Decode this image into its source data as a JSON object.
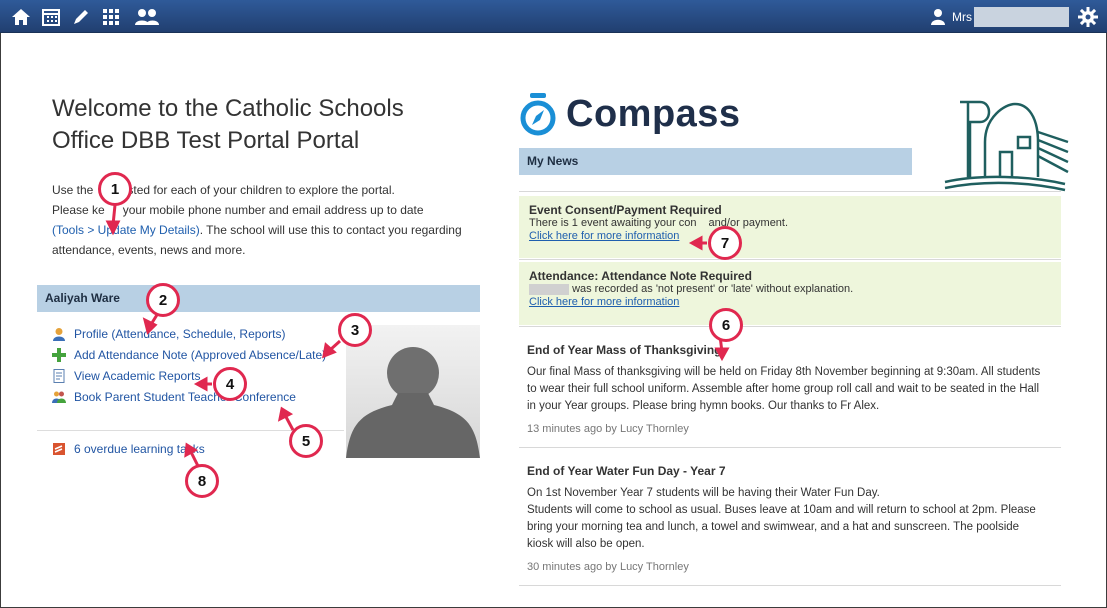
{
  "topbar": {
    "user_label": "Mrs",
    "nav_icons": [
      "home-icon",
      "calendar-icon",
      "pencil-icon",
      "grid-icon",
      "people-icon"
    ],
    "settings_icon": "gear-icon"
  },
  "welcome": {
    "title": "Welcome to the Catholic Schools Office DBB Test Portal Portal",
    "intro_before_link_1": "Use the",
    "intro_after_1": "sted for each of your children to explore the portal.",
    "intro_line_2_a": "Please ke",
    "intro_line_2_b": "your mobile phone number and email address up to date",
    "tools_link": "(Tools > Update My Details)",
    "intro_after_link": ". The school will use this to contact you regarding attendance, events, news and more."
  },
  "child": {
    "name": "Aaliyah Ware",
    "links": [
      {
        "label": "Profile (Attendance, Schedule, Reports)",
        "icon": "profile-icon"
      },
      {
        "label": "Add Attendance Note (Approved Absence/Late)",
        "icon": "plus-icon"
      },
      {
        "label": "View Academic Reports",
        "icon": "report-icon"
      },
      {
        "label": "Book Parent Student Teacher Conference",
        "icon": "conference-icon"
      }
    ],
    "overdue_label": "6 overdue learning tasks"
  },
  "brand": {
    "logo_text": "Compass"
  },
  "news": {
    "header": "My News",
    "alerts": [
      {
        "title": "Event Consent/Payment Required",
        "body": "There is 1 event awaiting your con",
        "body_end": "and/or payment.",
        "link": "Click here for more information"
      },
      {
        "title": "Attendance: Attendance Note Required",
        "body": "was recorded as 'not present' or 'late' without explanation.",
        "link": "Click here for more information"
      }
    ],
    "items": [
      {
        "title": "End of Year Mass of Thanksgiving",
        "body": "Our final Mass of thanksgiving will be held on Friday 8th November beginning at 9:30am.  All students to wear their full school uniform.  Assemble after home group roll call and wait to be seated in the Hall in your Year groups. Please bring hymn books.  Our thanks to Fr Alex.",
        "meta": "13 minutes ago by Lucy Thornley"
      },
      {
        "title": "End of Year Water Fun Day - Year 7",
        "body_lines": [
          "On 1st November Year 7 students will be having their Water Fun Day.",
          "Students will come to school as usual.  Buses leave at 10am and will return to school at 2pm. Please bring your morning tea and lunch, a towel and swimwear, and a hat and sunscreen.  The poolside kiosk will also be open."
        ],
        "meta": "30 minutes ago by Lucy Thornley"
      }
    ]
  },
  "callouts": [
    "1",
    "2",
    "3",
    "4",
    "5",
    "6",
    "7",
    "8"
  ],
  "colors": {
    "callout": "#e0284f",
    "topbar": "#2a4f8a",
    "header_blue": "#b8d0e4",
    "alert_bg": "#eef6dc",
    "link": "#2155a3"
  }
}
